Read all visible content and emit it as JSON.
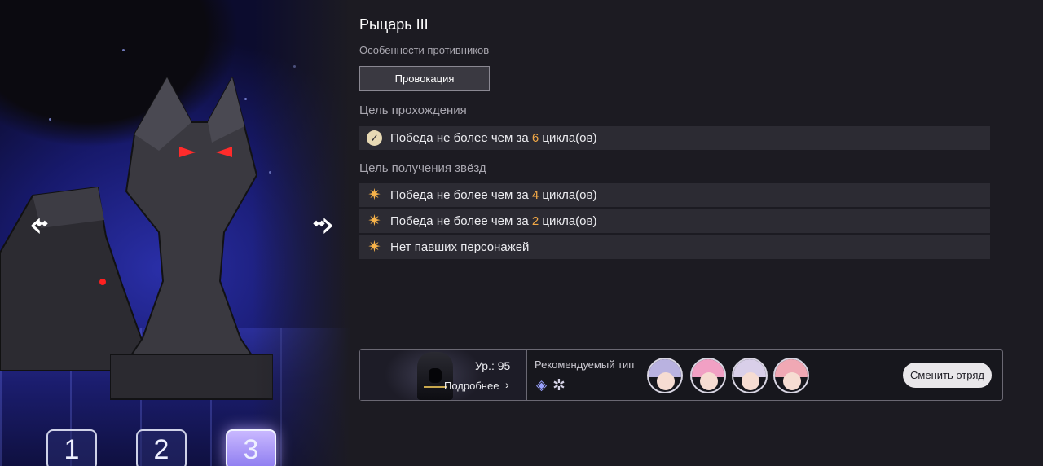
{
  "stage": {
    "title": "Рыцарь III",
    "enemy_traits_label": "Особенности противников",
    "trait_button": "Провокация"
  },
  "clear_goal": {
    "label": "Цель прохождения",
    "items": [
      {
        "icon": "check-icon",
        "prefix": "Победа не более чем за ",
        "number": "6",
        "suffix": " цикла(ов)"
      }
    ]
  },
  "star_goals": {
    "label": "Цель получения звёзд",
    "items": [
      {
        "icon": "star-icon",
        "prefix": "Победа не более чем за ",
        "number": "4",
        "suffix": " цикла(ов)"
      },
      {
        "icon": "star-icon",
        "prefix": "Победа не более чем за ",
        "number": "2",
        "suffix": " цикла(ов)"
      },
      {
        "icon": "star-icon",
        "prefix": "Нет павших персонажей",
        "number": "",
        "suffix": ""
      }
    ]
  },
  "enemy": {
    "level": "Ур.: 95",
    "details_label": "Подробнее"
  },
  "recommended": {
    "label": "Рекомендуемый тип",
    "type_icons": [
      "imaginary-type-icon",
      "harmony-path-icon"
    ],
    "characters": [
      {
        "name": "avatar-1",
        "hair": "#b9b2e0"
      },
      {
        "name": "avatar-2",
        "hair": "#f1a0c4"
      },
      {
        "name": "avatar-3",
        "hair": "#d9cfe9"
      },
      {
        "name": "avatar-4",
        "hair": "#f0a8b4"
      }
    ]
  },
  "switch_team_button": "Сменить отряд",
  "stages": [
    {
      "label": "1",
      "active": false
    },
    {
      "label": "2",
      "active": false
    },
    {
      "label": "3",
      "active": true
    }
  ],
  "colors": {
    "accent_number": "#f3a946",
    "star": "#f7b34a",
    "panel_row": "#2c2b33"
  }
}
